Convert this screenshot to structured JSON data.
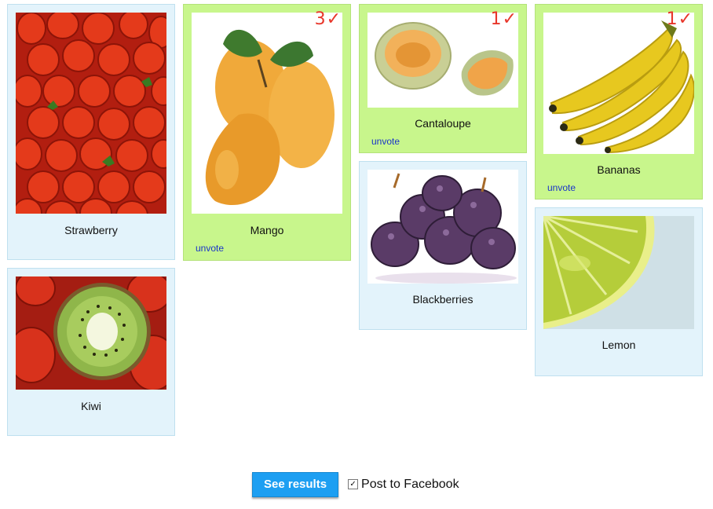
{
  "items": [
    {
      "name": "Strawberry",
      "image_icon": "strawberry-image",
      "voted": false
    },
    {
      "name": "Mango",
      "image_icon": "mango-image",
      "voted": true,
      "votes": "3",
      "check": "✓",
      "unvote": "unvote"
    },
    {
      "name": "Cantaloupe",
      "image_icon": "cantaloupe-image",
      "voted": true,
      "votes": "1",
      "check": "✓",
      "unvote": "unvote"
    },
    {
      "name": "Bananas",
      "image_icon": "bananas-image",
      "voted": true,
      "votes": "1",
      "check": "✓",
      "unvote": "unvote"
    },
    {
      "name": "Kiwi",
      "image_icon": "kiwi-image",
      "voted": false
    },
    {
      "name": "Blackberries",
      "image_icon": "blackberries-image",
      "voted": false
    },
    {
      "name": "Lemon",
      "image_icon": "lemon-image",
      "voted": false
    }
  ],
  "actions": {
    "see_results": "See results",
    "post_to_facebook": "Post to Facebook",
    "post_to_facebook_checked": true,
    "checkmark": "✓"
  },
  "colors": {
    "voted_bg": "#c8f68c",
    "default_bg": "#e3f3fb",
    "button": "#1d9ff2",
    "vote_badge": "#e8362a",
    "link": "#1a35c9"
  }
}
